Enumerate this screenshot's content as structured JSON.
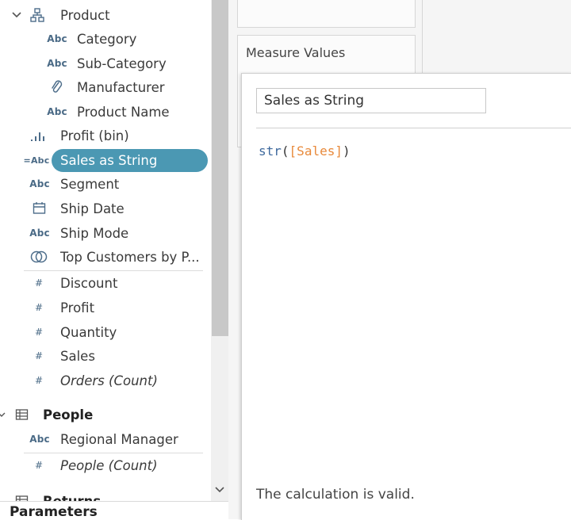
{
  "data_pane": {
    "product_folder": {
      "label": "Product",
      "expand_icon": "chevron-down-icon",
      "icon": "hierarchy-icon"
    },
    "product_children": [
      {
        "icon": "Abc",
        "label": "Category"
      },
      {
        "icon": "Abc",
        "label": "Sub-Category"
      },
      {
        "icon": "paperclip-icon",
        "label": "Manufacturer"
      },
      {
        "icon": "Abc",
        "label": "Product Name"
      }
    ],
    "fields": [
      {
        "icon": "bin-bars-icon",
        "label": "Profit (bin)"
      },
      {
        "icon": "=Abc",
        "label": "Sales as String",
        "selected": true
      },
      {
        "icon": "Abc",
        "label": "Segment"
      },
      {
        "icon": "calendar-icon",
        "label": "Ship Date"
      },
      {
        "icon": "Abc",
        "label": "Ship Mode"
      },
      {
        "icon": "set-icon",
        "label": "Top Customers by P..."
      }
    ],
    "measures": [
      {
        "icon": "#",
        "label": "Discount"
      },
      {
        "icon": "#",
        "label": "Profit"
      },
      {
        "icon": "#",
        "label": "Quantity"
      },
      {
        "icon": "#",
        "label": "Sales"
      },
      {
        "icon": "#",
        "label": "Orders (Count)",
        "italic": true
      }
    ],
    "people_table": {
      "label": "People",
      "expand_icon": "chevron-down-icon",
      "icon": "table-icon",
      "fields": [
        {
          "icon": "Abc",
          "label": "Regional Manager"
        },
        {
          "icon": "#",
          "label": "People (Count)",
          "italic": true
        }
      ]
    },
    "partial_next_table": "Returns",
    "parameters_header": "Parameters"
  },
  "shelves": {
    "measure_values_label": "Measure Values"
  },
  "calc_editor": {
    "name": "Sales as String",
    "formula": {
      "function": "str",
      "open_paren": "(",
      "field": "[Sales]",
      "close_paren": ")"
    },
    "status": "The calculation is valid."
  },
  "colors": {
    "selection": "#4b98b3",
    "measure_icon": "#3f9e77",
    "dimension_icon": "#4d6d8a",
    "formula_field": "#e8893a",
    "formula_function": "#3f6a9e"
  }
}
